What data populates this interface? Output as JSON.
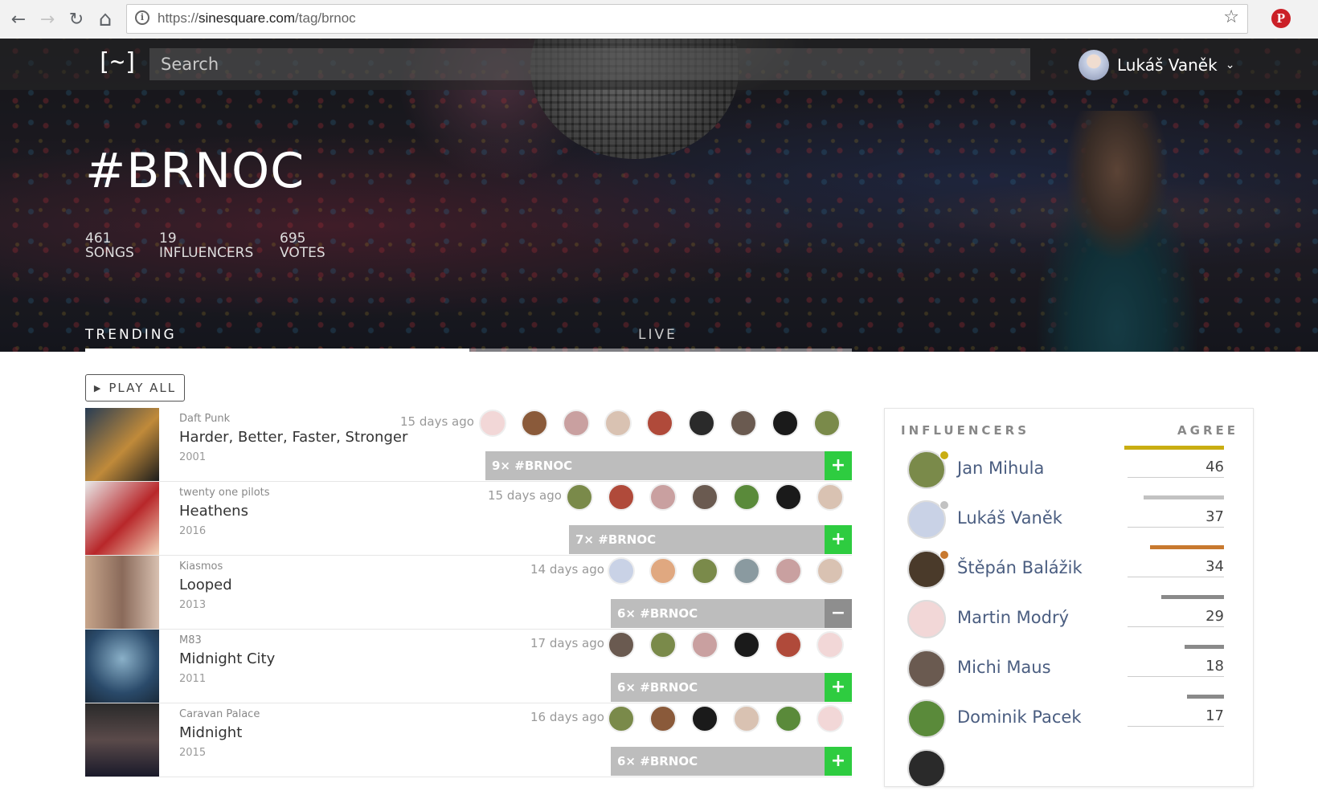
{
  "browser": {
    "url_prefix": "https://",
    "url_host": "sinesquare.com",
    "url_path": "/tag/brnoc",
    "nav": {
      "back": "←",
      "forward": "→",
      "reload": "↻",
      "home": "⌂",
      "star": "☆",
      "pinterest": "P"
    }
  },
  "header": {
    "logo": "[~]",
    "search_placeholder": "Search",
    "user_name": "Lukáš Vaněk"
  },
  "hero": {
    "tag_title": "#BRNOC",
    "stats": [
      {
        "num": "461",
        "label": "SONGS"
      },
      {
        "num": "19",
        "label": "INFLUENCERS"
      },
      {
        "num": "695",
        "label": "VOTES"
      }
    ],
    "tabs": [
      {
        "label": "TRENDING"
      },
      {
        "label": "LIVE"
      }
    ]
  },
  "play_all_label": "PLAY ALL",
  "songs": [
    {
      "artist": "Daft Punk",
      "title": "Harder, Better, Faster, Stronger",
      "year": "2001",
      "ago": "15 days ago",
      "count": "9×",
      "tag": "#BRNOC",
      "action": "+"
    },
    {
      "artist": "twenty one pilots",
      "title": "Heathens",
      "year": "2016",
      "ago": "15 days ago",
      "count": "7×",
      "tag": "#BRNOC",
      "action": "+"
    },
    {
      "artist": "Kiasmos",
      "title": "Looped",
      "year": "2013",
      "ago": "14 days ago",
      "count": "6×",
      "tag": "#BRNOC",
      "action": "−"
    },
    {
      "artist": "M83",
      "title": "Midnight City",
      "year": "2011",
      "ago": "17 days ago",
      "count": "6×",
      "tag": "#BRNOC",
      "action": "+"
    },
    {
      "artist": "Caravan Palace",
      "title": "Midnight",
      "year": "2015",
      "ago": "16 days ago",
      "count": "6×",
      "tag": "#BRNOC",
      "action": "+"
    }
  ],
  "influencers": {
    "heading": "INFLUENCERS",
    "agree_heading": "AGREE",
    "rows": [
      {
        "name": "Jan Mihula",
        "count": "46",
        "color": "#c9ad12"
      },
      {
        "name": "Lukáš Vaněk",
        "count": "37",
        "color": "#c2c2c2"
      },
      {
        "name": "Štěpán Balážik",
        "count": "34",
        "color": "#c8792f"
      },
      {
        "name": "Martin Modrý",
        "count": "29",
        "color": "#8a8a8a"
      },
      {
        "name": "Michi Maus",
        "count": "18",
        "color": "#8a8a8a"
      },
      {
        "name": "Dominik Pacek",
        "count": "17",
        "color": "#8a8a8a"
      }
    ]
  }
}
